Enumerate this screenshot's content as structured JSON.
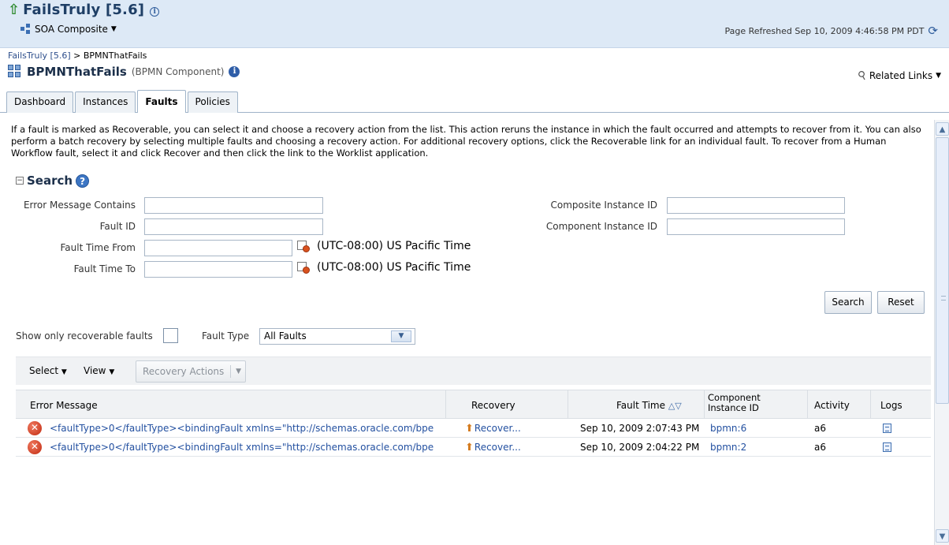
{
  "header": {
    "title": "FailsTruly [5.6]",
    "soa_menu": "SOA Composite",
    "refreshed": "Page Refreshed Sep 10, 2009 4:46:58 PM PDT"
  },
  "breadcrumb": {
    "root": "FailsTruly [5.6]",
    "sep": " > ",
    "current": "BPMNThatFails"
  },
  "component": {
    "name": "BPMNThatFails",
    "type": "(BPMN Component)",
    "related_links": "Related Links"
  },
  "tabs": [
    {
      "label": "Dashboard",
      "active": false
    },
    {
      "label": "Instances",
      "active": false
    },
    {
      "label": "Faults",
      "active": true
    },
    {
      "label": "Policies",
      "active": false
    }
  ],
  "help_text": "If a fault is marked as Recoverable, you can select it and choose a recovery action from the list. This action reruns the instance in which the fault occurred and attempts to recover from it. You can also perform a batch recovery by selecting multiple faults and choosing a recovery action. For additional recovery options, click the Recoverable link for an individual fault. To recover from a Human Workflow fault, select it and click Recover and then click the link to the Worklist application.",
  "search": {
    "title": "Search",
    "labels": {
      "error_message": "Error Message Contains",
      "fault_id": "Fault ID",
      "fault_time_from": "Fault Time From",
      "fault_time_to": "Fault Time To",
      "composite_instance_id": "Composite Instance ID",
      "component_instance_id": "Component Instance ID"
    },
    "timezone": "(UTC-08:00) US Pacific Time",
    "search_button": "Search",
    "reset_button": "Reset"
  },
  "filters": {
    "recoverable_label": "Show only recoverable faults",
    "fault_type_label": "Fault Type",
    "fault_type_value": "All Faults"
  },
  "toolbar": {
    "select": "Select",
    "view": "View",
    "recovery_actions": "Recovery Actions"
  },
  "table": {
    "headers": {
      "error_message": "Error Message",
      "recovery": "Recovery",
      "fault_time": "Fault Time",
      "component_instance_id_1": "Component",
      "component_instance_id_2": "Instance ID",
      "activity": "Activity",
      "logs": "Logs"
    },
    "rows": [
      {
        "error": "<faultType>0</faultType><bindingFault xmlns=\"http://schemas.oracle.com/bpe",
        "recovery": "Recover...",
        "fault_time": "Sep 10, 2009 2:07:43 PM",
        "instance_id": "bpmn:6",
        "activity": "a6"
      },
      {
        "error": "<faultType>0</faultType><bindingFault xmlns=\"http://schemas.oracle.com/bpe",
        "recovery": "Recover...",
        "fault_time": "Sep 10, 2009 2:04:22 PM",
        "instance_id": "bpmn:2",
        "activity": "a6"
      }
    ]
  }
}
